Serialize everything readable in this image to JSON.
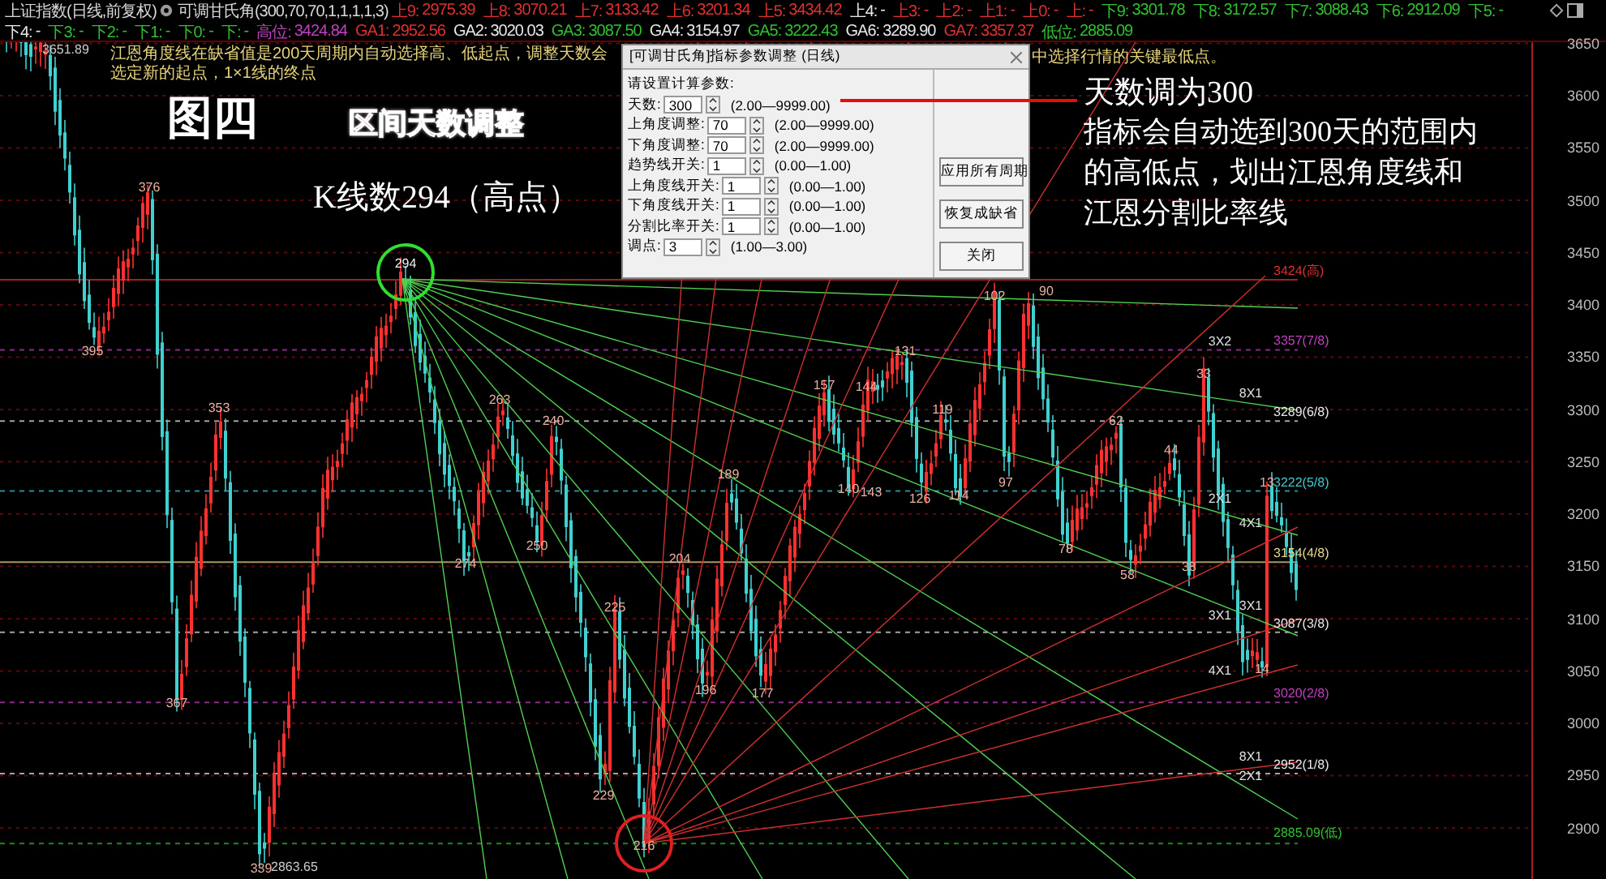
{
  "header": {
    "title": "上证指数(日线,前复权)",
    "indicator": "可调甘氏角(300,70,70,1,1,1,1,3)",
    "line1": [
      {
        "label": "上9:",
        "value": "2975.39",
        "color": "#e03030"
      },
      {
        "label": "上8:",
        "value": "3070.21",
        "color": "#e03030"
      },
      {
        "label": "上7:",
        "value": "3133.42",
        "color": "#e03030"
      },
      {
        "label": "上6:",
        "value": "3201.34",
        "color": "#e03030"
      },
      {
        "label": "上5:",
        "value": "3434.42",
        "color": "#e03030"
      },
      {
        "label": "上4:",
        "value": "-",
        "color": "#e8e8e8"
      },
      {
        "label": "上3:",
        "value": "-",
        "color": "#e03030"
      },
      {
        "label": "上2:",
        "value": "-",
        "color": "#e03030"
      },
      {
        "label": "上1:",
        "value": "-",
        "color": "#e03030"
      },
      {
        "label": "上0:",
        "value": "-",
        "color": "#e03030"
      },
      {
        "label": "上:",
        "value": "-",
        "color": "#e03030"
      },
      {
        "label": "下9:",
        "value": "3301.78",
        "color": "#30c030"
      },
      {
        "label": "下8:",
        "value": "3172.57",
        "color": "#30c030"
      },
      {
        "label": "下7:",
        "value": "3088.43",
        "color": "#30c030"
      },
      {
        "label": "下6:",
        "value": "2912.09",
        "color": "#30c030"
      },
      {
        "label": "下5:",
        "value": "-",
        "color": "#30c030"
      }
    ],
    "line2": [
      {
        "label": "下4:",
        "value": "-",
        "color": "#e8e8e8"
      },
      {
        "label": "下3:",
        "value": "-",
        "color": "#30c030"
      },
      {
        "label": "下2:",
        "value": "-",
        "color": "#30c030"
      },
      {
        "label": "下1:",
        "value": "-",
        "color": "#30c030"
      },
      {
        "label": "下0:",
        "value": "-",
        "color": "#30c030"
      },
      {
        "label": "下:",
        "value": "-",
        "color": "#30c030"
      },
      {
        "label": "高位:",
        "value": "3424.84",
        "color": "#c040c0"
      },
      {
        "label": "GA1:",
        "value": "2952.56",
        "color": "#e03030"
      },
      {
        "label": "GA2:",
        "value": "3020.03",
        "color": "#e8e8e8"
      },
      {
        "label": "GA3:",
        "value": "3087.50",
        "color": "#30c030"
      },
      {
        "label": "GA4:",
        "value": "3154.97",
        "color": "#e8e8e8"
      },
      {
        "label": "GA5:",
        "value": "3222.43",
        "color": "#30c030"
      },
      {
        "label": "GA6:",
        "value": "3289.90",
        "color": "#e8e8e8"
      },
      {
        "label": "GA7:",
        "value": "3357.37",
        "color": "#e03030"
      },
      {
        "label": "低位:",
        "value": "2885.09",
        "color": "#30c030"
      }
    ]
  },
  "note": [
    "江恩角度线在缺省值是200天周期内自动选择高、低起点，调整天数会选定新的起点，1×1线的终点",
    "中选择行情的关键最低点。"
  ],
  "chart": {
    "high_label": "3651.89",
    "low_label": "2863.65",
    "bar_labels": [
      "376",
      "395",
      "353",
      "367",
      "339",
      "294",
      "263",
      "240",
      "274",
      "250",
      "225",
      "229",
      "216",
      "204",
      "189",
      "196",
      "177",
      "157",
      "144",
      "131",
      "140",
      "143",
      "126",
      "119",
      "114",
      "102",
      "90",
      "97",
      "78",
      "62",
      "58",
      "44",
      "38",
      "33",
      "13",
      "14"
    ],
    "gann_labels": [
      "3X2",
      "8X1",
      "2X1",
      "4X1",
      "3X1",
      "3X1",
      "4X1",
      "8X1",
      "2X1"
    ],
    "levels": [
      {
        "label": "3424(高)",
        "color": "#e03030"
      },
      {
        "label": "3357(7/8)",
        "color": "#c040c0"
      },
      {
        "label": "3289(6/8)",
        "color": "#e8e8e8"
      },
      {
        "label": "3222(5/8)",
        "color": "#40c8d0"
      },
      {
        "label": "3154(4/8)",
        "color": "#e8d890"
      },
      {
        "label": "3087(3/8)",
        "color": "#e8e8e8"
      },
      {
        "label": "3020(2/8)",
        "color": "#c040c0"
      },
      {
        "label": "2952(1/8)",
        "color": "#e8e8e8"
      },
      {
        "label": "2885.09(低)",
        "color": "#30c030"
      }
    ]
  },
  "price_axis": [
    "3650",
    "3600",
    "3550",
    "3500",
    "3450",
    "3400",
    "3350",
    "3300",
    "3250",
    "3200",
    "3150",
    "3100",
    "3050",
    "3000",
    "2950",
    "2900"
  ],
  "annotations": {
    "figure": "图四",
    "topic": "区间天数调整",
    "kline": "K线数294（高点）",
    "explain": [
      "天数调为300",
      "指标会自动选到300天的范围内",
      "的高低点，划出江恩角度线和",
      "江恩分割比率线"
    ]
  },
  "dialog": {
    "title": "[可调甘氏角]指标参数调整 (日线)",
    "prompt": "请设置计算参数:",
    "params": [
      {
        "label": "天数:",
        "value": "300",
        "range": "(2.00—9999.00)"
      },
      {
        "label": "上角度调整:",
        "value": "70",
        "range": "(2.00—9999.00)"
      },
      {
        "label": "下角度调整:",
        "value": "70",
        "range": "(2.00—9999.00)"
      },
      {
        "label": "趋势线开关:",
        "value": "1",
        "range": "(0.00—1.00)"
      },
      {
        "label": "上角度线开关:",
        "value": "1",
        "range": "(0.00—1.00)"
      },
      {
        "label": "下角度线开关:",
        "value": "1",
        "range": "(0.00—1.00)"
      },
      {
        "label": "分割比率开关:",
        "value": "1",
        "range": "(0.00—1.00)"
      },
      {
        "label": "调点:",
        "value": "3",
        "range": "(1.00—3.00)"
      }
    ],
    "buttons": [
      "应用所有周期",
      "恢复成缺省",
      "关闭"
    ]
  }
}
